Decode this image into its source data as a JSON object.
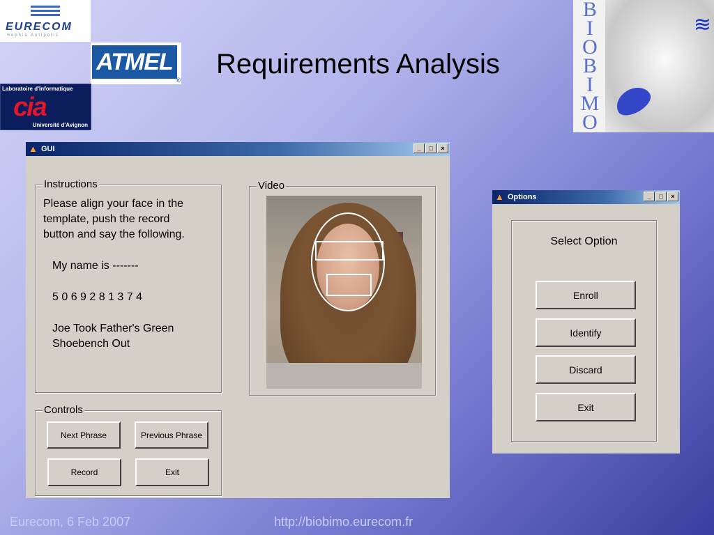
{
  "slide": {
    "title": "Requirements Analysis",
    "footer_left": "Eurecom, 6 Feb 2007",
    "footer_right": "http://biobimo.eurecom.fr"
  },
  "logos": {
    "eurecom": "EURECOM",
    "eurecom_sub": "Sophia Antipolis",
    "atmel": "ATMEL",
    "atmel_reg": "®",
    "lia_top": "Laboratoire d'Informatique",
    "lia_bottom": "Université d'Avignon",
    "biobimo_letters": [
      "B",
      "I",
      "O",
      "B",
      "I",
      "M",
      "O"
    ]
  },
  "gui_window": {
    "title": "GUI",
    "instructions": {
      "legend": "Instructions",
      "lines": [
        "Please align your face in the",
        "template, push the record",
        "button and say the following.",
        "My name is -------",
        "5 0 6 9 2 8 1 3 7 4",
        "Joe Took Father's Green",
        "Shoebench Out"
      ]
    },
    "video": {
      "legend": "Video"
    },
    "controls": {
      "legend": "Controls",
      "next_phrase": "Next Phrase",
      "previous_phrase": "Previous Phrase",
      "record": "Record",
      "exit": "Exit"
    }
  },
  "options_window": {
    "title": "Options",
    "heading": "Select Option",
    "buttons": [
      "Enroll",
      "Identify",
      "Discard",
      "Exit"
    ]
  },
  "window_buttons": {
    "minimize": "_",
    "maximize": "□",
    "close": "×"
  },
  "colors": {
    "titlebar_start": "#0a246a",
    "titlebar_end": "#a6caf0",
    "window_face": "#d4d0c8",
    "footer_text": "#c9cbf5"
  }
}
